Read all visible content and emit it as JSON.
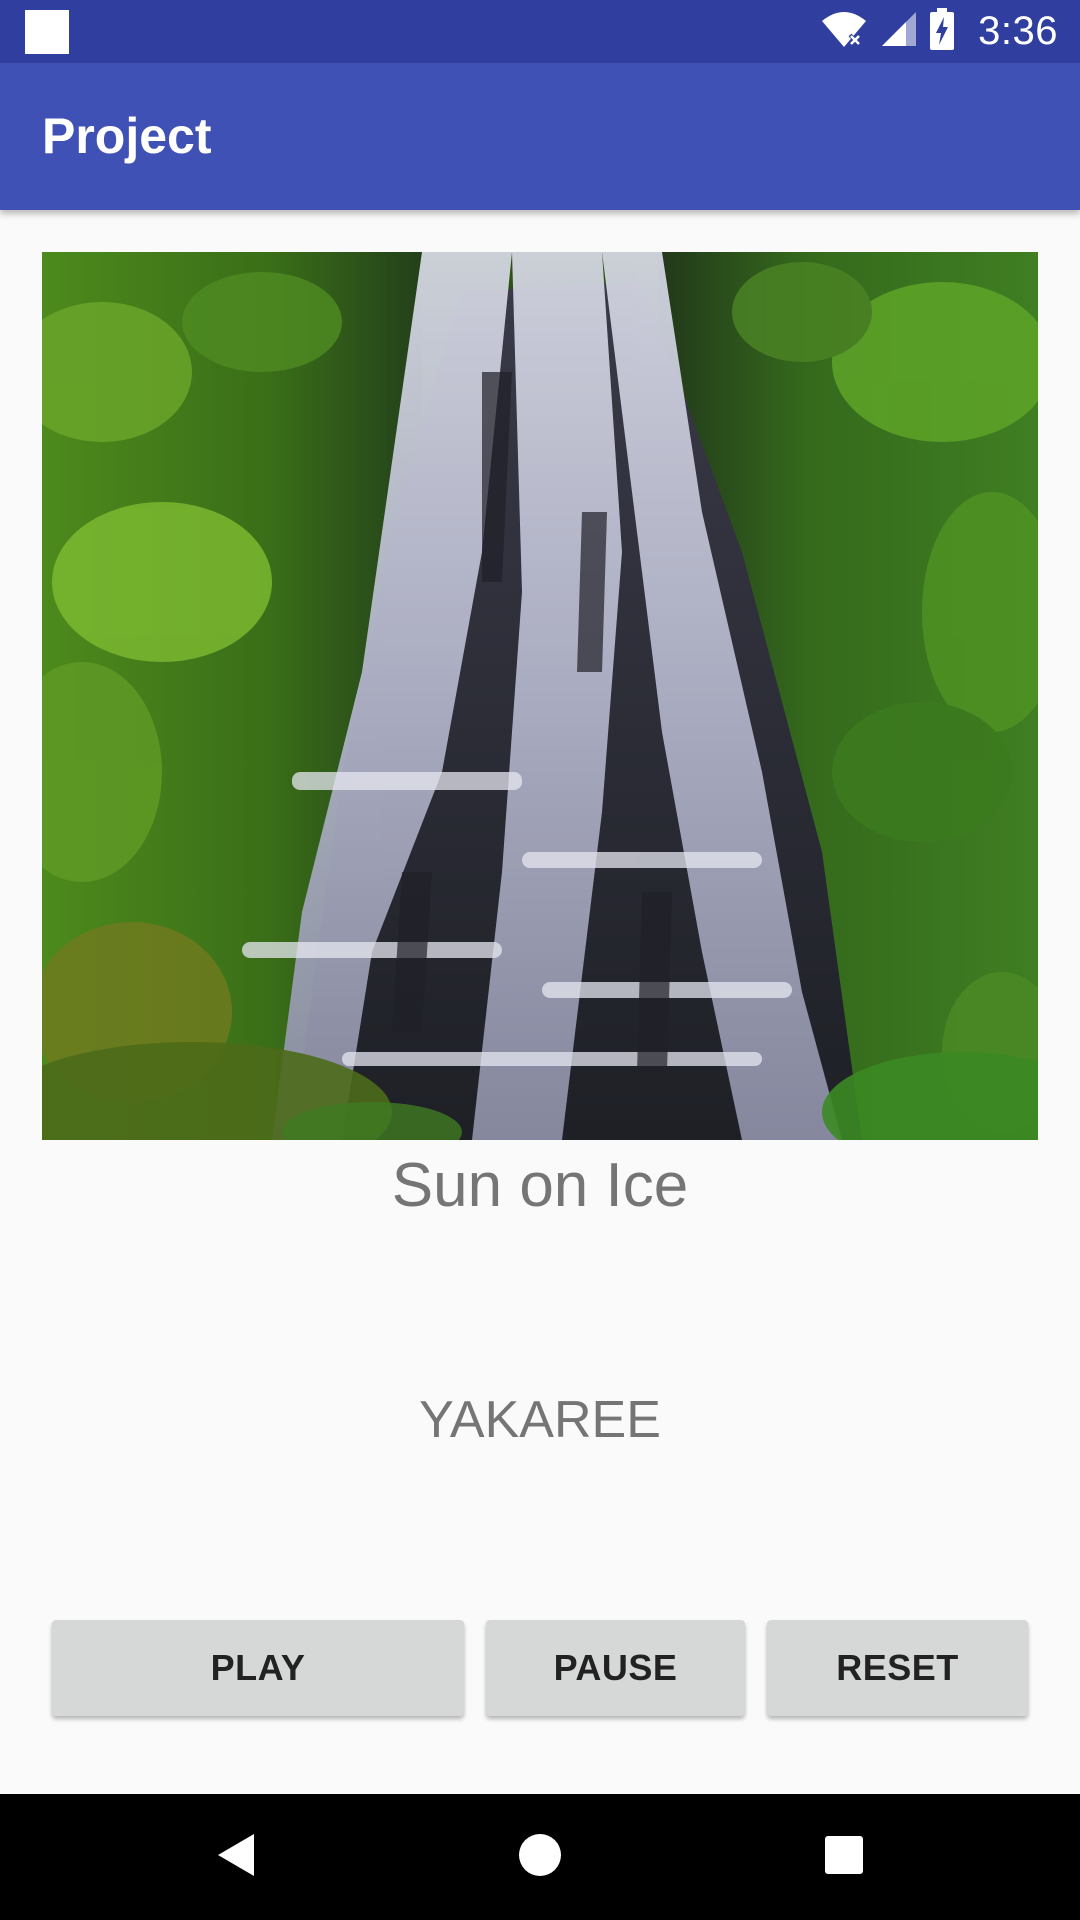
{
  "status_bar": {
    "time": "3:36",
    "icons": [
      "notification-square-icon",
      "wifi-icon",
      "cellular-signal-icon",
      "battery-charging-icon"
    ]
  },
  "app_bar": {
    "title": "Project"
  },
  "main": {
    "image": {
      "icon": "waterfall-image"
    },
    "song_title": "Sun on Ice",
    "artist": "YAKAREE"
  },
  "controls": {
    "play_label": "PLAY",
    "pause_label": "PAUSE",
    "reset_label": "RESET"
  },
  "nav_bar": {
    "icons": [
      "back-icon",
      "home-icon",
      "recents-icon"
    ]
  },
  "colors": {
    "status_bar": "#303f9f",
    "app_bar": "#3f51b5",
    "background": "#fafafa",
    "text_secondary": "#757575",
    "button": "#d6d7d7"
  }
}
